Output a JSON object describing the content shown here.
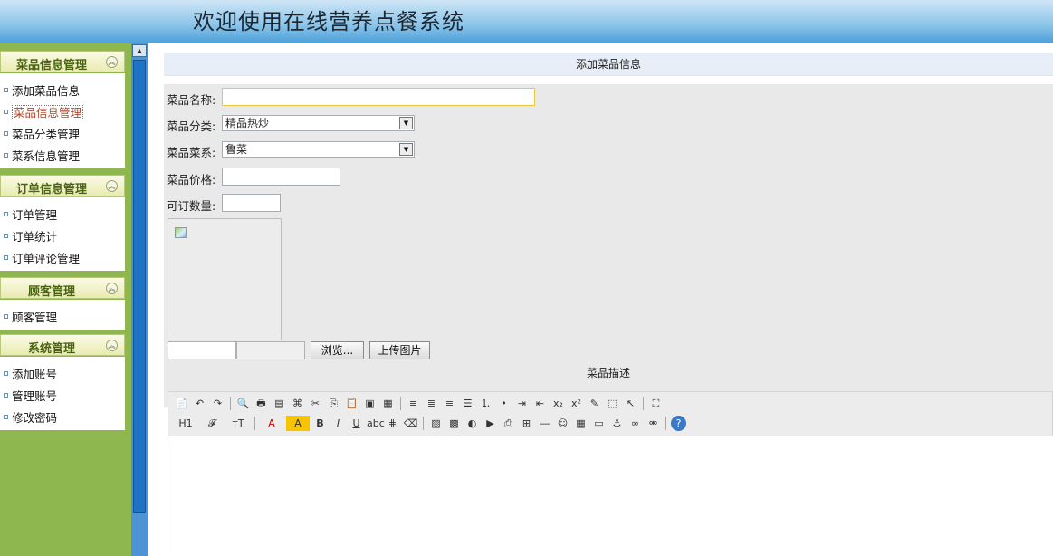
{
  "header": {
    "title": "欢迎使用在线营养点餐系统"
  },
  "sidebar": {
    "groups": [
      {
        "title": "菜品信息管理",
        "items": [
          "添加菜品信息",
          "菜品信息管理",
          "菜品分类管理",
          "菜系信息管理"
        ]
      },
      {
        "title": "订单信息管理",
        "items": [
          "订单管理",
          "订单统计",
          "订单评论管理"
        ]
      },
      {
        "title": "顾客管理",
        "items": [
          "顾客管理"
        ]
      },
      {
        "title": "系统管理",
        "items": [
          "添加账号",
          "管理账号",
          "修改密码"
        ]
      }
    ],
    "active_item": "菜品信息管理",
    "collapse_icon": "double-chevron-up-icon"
  },
  "main": {
    "section_title": "添加菜品信息",
    "form": {
      "name_label": "菜品名称:",
      "name_value": "",
      "category_label": "菜品分类:",
      "category_selected": "精品热炒",
      "cuisine_label": "菜品菜系:",
      "cuisine_selected": "鲁菜",
      "price_label": "菜品价格:",
      "price_value": "",
      "quantity_label": "可订数量:",
      "quantity_value": "",
      "browse_button": "浏览...",
      "upload_button": "上传图片"
    },
    "description_title": "菜品描述",
    "toolbar": {
      "row1": [
        "source-icon",
        "undo-icon",
        "redo-icon",
        "|",
        "preview-icon",
        "print-icon",
        "template-icon",
        "code-icon",
        "cut-icon",
        "copy-icon",
        "paste-icon",
        "paste-text-icon",
        "paste-word-icon",
        "|",
        "align-left-icon",
        "align-center-icon",
        "align-right-icon",
        "align-justify-icon",
        "ordered-list-icon",
        "unordered-list-icon",
        "indent-icon",
        "outdent-icon",
        "subscript-icon",
        "superscript-icon",
        "clear-format-icon",
        "select-all-icon",
        "cursor-icon",
        "|",
        "fullscreen-icon"
      ],
      "row2": [
        "heading-icon",
        "font-family-icon",
        "font-size-icon",
        "|",
        "font-color-icon",
        "highlight-icon",
        "bold-icon",
        "italic-icon",
        "underline-icon",
        "strikethrough-icon",
        "line-height-icon",
        "remove-format-icon",
        "|",
        "image-icon",
        "multi-image-icon",
        "flash-icon",
        "media-icon",
        "attachment-icon",
        "table-icon",
        "hr-icon",
        "emoticon-icon",
        "map-icon",
        "pagebreak-icon",
        "anchor-icon",
        "link-icon",
        "unlink-icon",
        "|",
        "help-icon"
      ]
    }
  }
}
